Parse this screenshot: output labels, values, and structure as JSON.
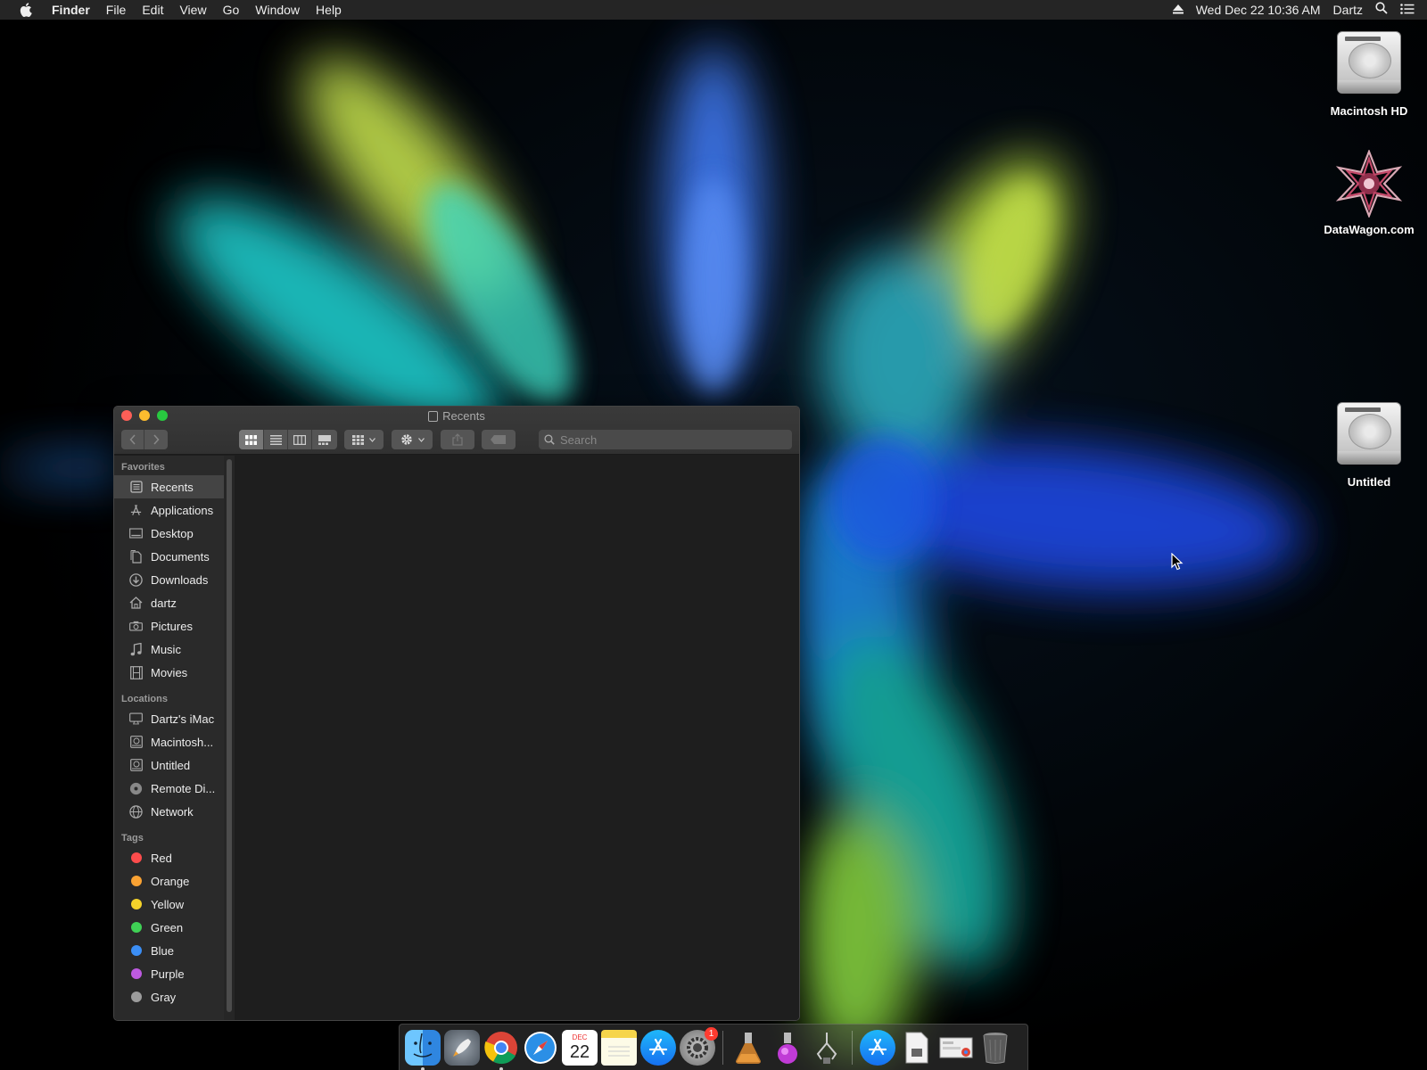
{
  "menubar": {
    "app_name": "Finder",
    "menus": [
      "File",
      "Edit",
      "View",
      "Go",
      "Window",
      "Help"
    ],
    "clock": "Wed Dec 22  10:36 AM",
    "user": "Dartz"
  },
  "desktop": {
    "icons": [
      {
        "label": "Macintosh HD",
        "icon": "hard-drive-icon"
      },
      {
        "label": "DataWagon.com",
        "icon": "star-emblem-icon"
      },
      {
        "label": "Untitled",
        "icon": "hard-drive-icon"
      }
    ]
  },
  "window": {
    "title": "Recents",
    "search_placeholder": "Search",
    "sidebar": {
      "favorites_header": "Favorites",
      "favorites": [
        {
          "label": "Recents",
          "icon": "recents-icon",
          "selected": true
        },
        {
          "label": "Applications",
          "icon": "applications-icon"
        },
        {
          "label": "Desktop",
          "icon": "desktop-icon"
        },
        {
          "label": "Documents",
          "icon": "documents-icon"
        },
        {
          "label": "Downloads",
          "icon": "downloads-icon"
        },
        {
          "label": "dartz",
          "icon": "home-icon"
        },
        {
          "label": "Pictures",
          "icon": "camera-icon"
        },
        {
          "label": "Music",
          "icon": "music-note-icon"
        },
        {
          "label": "Movies",
          "icon": "film-icon"
        }
      ],
      "locations_header": "Locations",
      "locations": [
        {
          "label": "Dartz's iMac",
          "icon": "imac-icon"
        },
        {
          "label": "Macintosh...",
          "icon": "drive-icon"
        },
        {
          "label": "Untitled",
          "icon": "drive-icon"
        },
        {
          "label": "Remote Di...",
          "icon": "disc-icon"
        },
        {
          "label": "Network",
          "icon": "globe-icon"
        }
      ],
      "tags_header": "Tags",
      "tags": [
        {
          "label": "Red",
          "color": "#fc4c4c"
        },
        {
          "label": "Orange",
          "color": "#f9a233"
        },
        {
          "label": "Yellow",
          "color": "#f5d32a"
        },
        {
          "label": "Green",
          "color": "#3fd155"
        },
        {
          "label": "Blue",
          "color": "#3b8ef5"
        },
        {
          "label": "Purple",
          "color": "#bd5ae0"
        },
        {
          "label": "Gray",
          "color": "#9c9c9c"
        }
      ]
    }
  },
  "dock": {
    "notification_badge": "1",
    "calendar_day": "22",
    "calendar_month": "DEC"
  }
}
